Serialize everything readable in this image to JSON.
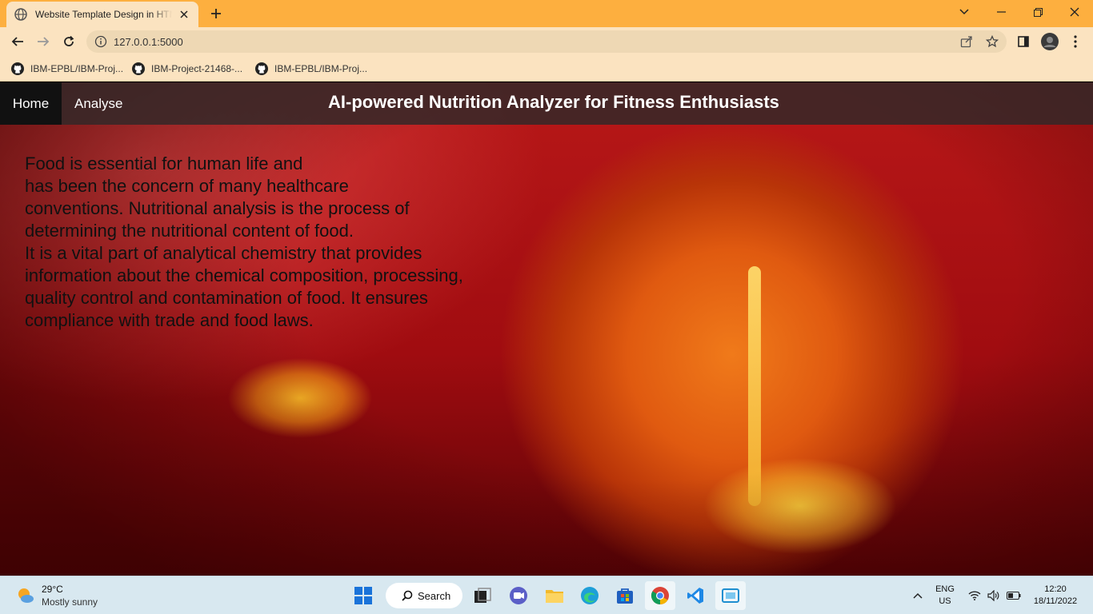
{
  "browser": {
    "tab_title": "Website Template Design in HTML",
    "url": "127.0.0.1:5000",
    "bookmarks": [
      {
        "label": "IBM-EPBL/IBM-Proj..."
      },
      {
        "label": "IBM-Project-21468-..."
      },
      {
        "label": "IBM-EPBL/IBM-Proj..."
      }
    ]
  },
  "page": {
    "nav": {
      "home": "Home",
      "analyse": "Analyse",
      "title": "AI-powered Nutrition Analyzer for Fitness Enthusiasts"
    },
    "intro_lines": [
      "Food is essential for human life and",
      "has been the concern of many healthcare",
      "conventions. Nutritional analysis is the process of",
      "determining the nutritional content of food.",
      "It is a vital part of analytical chemistry that provides",
      "information about the chemical composition, processing,",
      "quality control and contamination of food. It ensures",
      "compliance with trade and food laws."
    ]
  },
  "taskbar": {
    "weather": {
      "temp": "29°C",
      "condition": "Mostly sunny"
    },
    "search_label": "Search",
    "lang": {
      "line1": "ENG",
      "line2": "US"
    },
    "clock": {
      "time": "12:20",
      "date": "18/11/2022"
    }
  }
}
